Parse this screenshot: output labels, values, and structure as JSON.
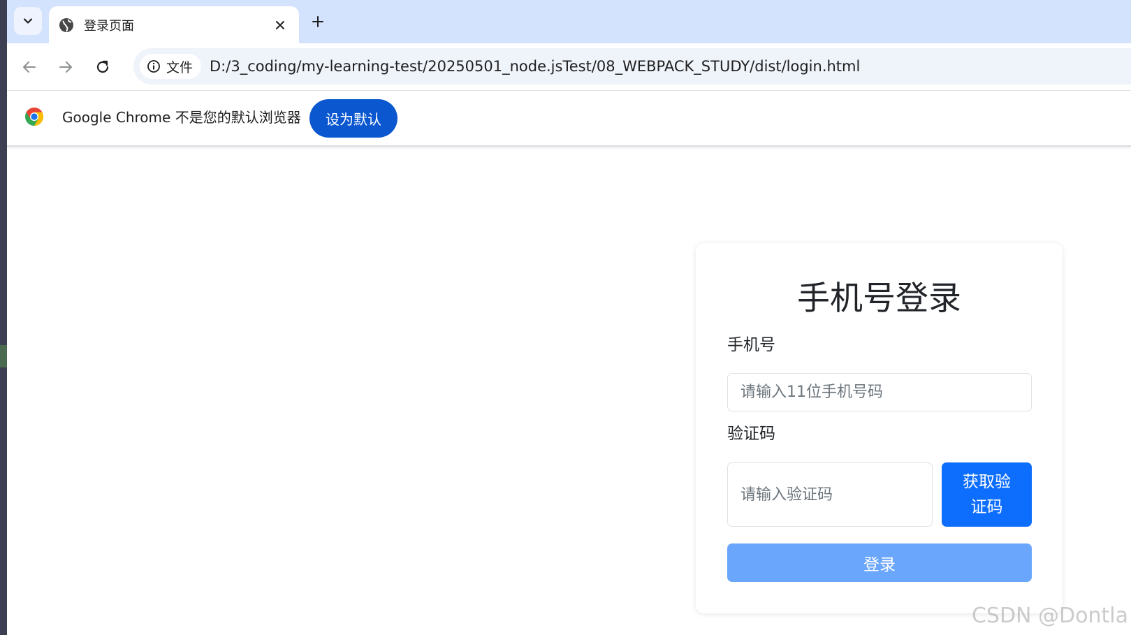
{
  "tab": {
    "title": "登录页面"
  },
  "toolbar": {
    "security_chip_label": "文件",
    "url": "D:/3_coding/my-learning-test/20250501_node.jsTest/08_WEBPACK_STUDY/dist/login.html"
  },
  "infobar": {
    "message": "Google Chrome 不是您的默认浏览器",
    "button_label": "设为默认"
  },
  "login_card": {
    "title": "手机号登录",
    "phone_label": "手机号",
    "phone_placeholder": "请输入11位手机号码",
    "code_label": "验证码",
    "code_placeholder": "请输入验证码",
    "get_code_button": "获取验证码",
    "login_button": "登录"
  },
  "watermark": "CSDN @Dontla",
  "colors": {
    "tabbar_bg": "#d3e3fd",
    "primary_button": "#0d6efd",
    "login_button_disabled": "#6aa6fb",
    "chrome_set_default": "#0b57d0"
  }
}
